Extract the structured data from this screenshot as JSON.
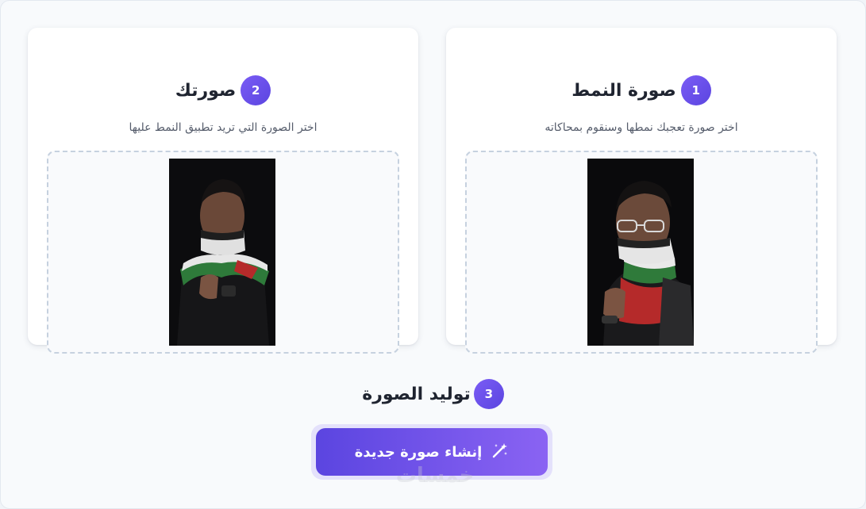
{
  "style_card": {
    "step": "1",
    "title": "صورة النمط",
    "subtitle": "اختر صورة تعجبك نمطها وسنقوم بمحاكاته"
  },
  "user_card": {
    "step": "2",
    "title": "صورتك",
    "subtitle": "اختر الصورة التي تريد تطبيق النمط عليها"
  },
  "generate_section": {
    "step": "3",
    "title": "توليد الصورة",
    "button_label": "إنشاء صورة جديدة",
    "button_icon": "magic-wand-icon"
  },
  "watermark": "خمسات",
  "colors": {
    "accent": "#6a4ff0",
    "badge": "#6b52ec",
    "dropzone_border": "#c6d1df",
    "background": "#f8fafc"
  }
}
